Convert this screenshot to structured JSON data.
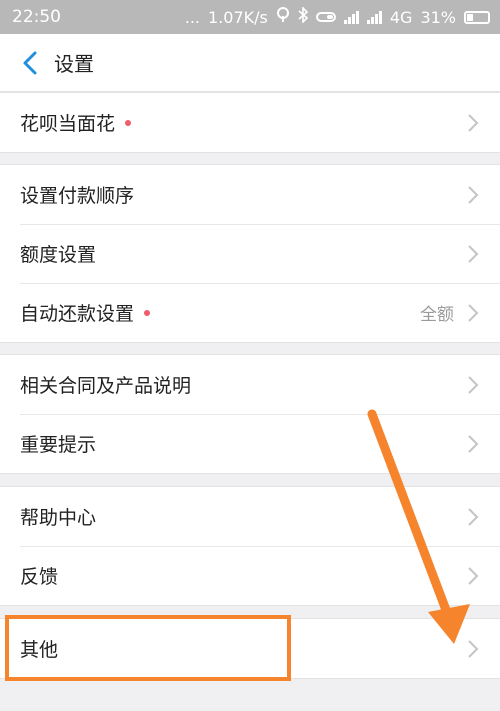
{
  "status_bar": {
    "time": "22:50",
    "dots": "...",
    "speed": "1.07K/s",
    "network": "4G",
    "battery": "31%"
  },
  "nav": {
    "title": "设置"
  },
  "sections": [
    [
      {
        "label": "花呗当面花",
        "dot": true,
        "value": ""
      }
    ],
    [
      {
        "label": "设置付款顺序",
        "dot": false,
        "value": ""
      },
      {
        "label": "额度设置",
        "dot": false,
        "value": ""
      },
      {
        "label": "自动还款设置",
        "dot": true,
        "value": "全额"
      }
    ],
    [
      {
        "label": "相关合同及产品说明",
        "dot": false,
        "value": ""
      },
      {
        "label": "重要提示",
        "dot": false,
        "value": ""
      }
    ],
    [
      {
        "label": "帮助中心",
        "dot": false,
        "value": ""
      },
      {
        "label": "反馈",
        "dot": false,
        "value": ""
      }
    ],
    [
      {
        "label": "其他",
        "dot": false,
        "value": ""
      }
    ]
  ],
  "colors": {
    "accent": "#1e8fe1",
    "dot": "#f05a6a",
    "annotation": "#f5842c",
    "chevron": "#c4c4c4"
  },
  "icons": {
    "back": "chevron-left-icon",
    "row_arrow": "chevron-right-icon"
  }
}
